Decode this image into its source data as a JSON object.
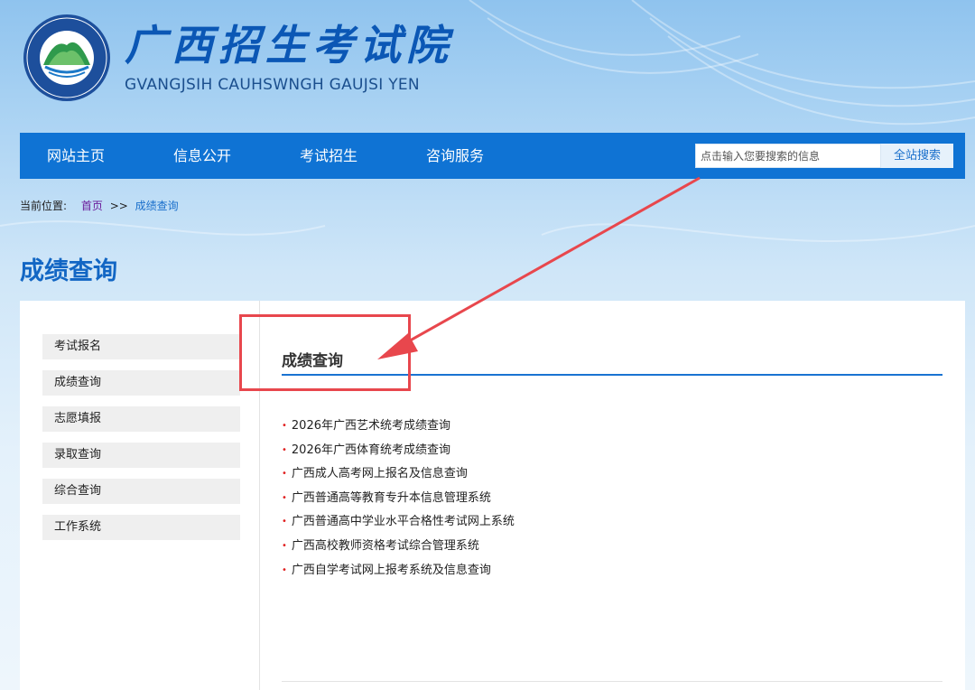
{
  "header": {
    "title": "广西招生考试院",
    "subtitle": "GVANGJSIH CAUHSWNGH GAUJSI YEN",
    "emblem_text": "广西招生考试院 GVANGJSIH CAUHSWNGH GAUJSI YEN"
  },
  "nav": {
    "items": [
      {
        "label": "网站主页"
      },
      {
        "label": "信息公开"
      },
      {
        "label": "考试招生"
      },
      {
        "label": "咨询服务"
      }
    ],
    "search_placeholder": "点击输入您要搜索的信息",
    "search_button": "全站搜索"
  },
  "breadcrumb": {
    "prefix": "当前位置:",
    "home": "首页",
    "separator": ">>",
    "current": "成绩查询"
  },
  "page_title": "成绩查询",
  "sidebar": {
    "items": [
      {
        "label": "考试报名"
      },
      {
        "label": "成绩查询"
      },
      {
        "label": "志愿填报"
      },
      {
        "label": "录取查询"
      },
      {
        "label": "综合查询"
      },
      {
        "label": "工作系统"
      }
    ]
  },
  "content": {
    "title": "成绩查询",
    "bullet": "•",
    "links": [
      {
        "label": "2026年广西艺术统考成绩查询"
      },
      {
        "label": "2026年广西体育统考成绩查询"
      },
      {
        "label": "广西成人高考网上报名及信息查询"
      },
      {
        "label": "广西普通高等教育专升本信息管理系统"
      },
      {
        "label": "广西普通高中学业水平合格性考试网上系统"
      },
      {
        "label": "广西高校教师资格考试综合管理系统"
      },
      {
        "label": "广西自学考试网上报考系统及信息查询"
      }
    ]
  },
  "colors": {
    "nav_blue": "#0f73d4",
    "title_blue": "#1266c4",
    "annotation_red": "#e8474d",
    "bullet_red": "#e02020"
  }
}
